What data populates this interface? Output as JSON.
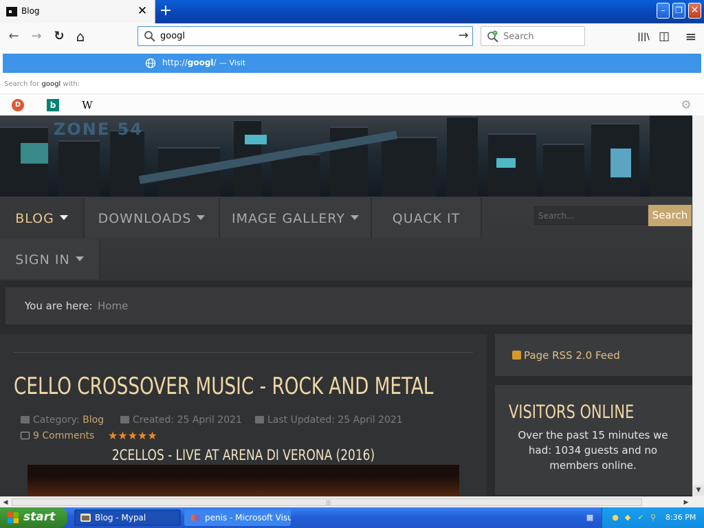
{
  "browser": {
    "tab": {
      "title": "Blog",
      "close": "✕"
    },
    "new_tab": "+",
    "window": {
      "minimize": "–",
      "restore": "❐",
      "close": "✕"
    },
    "nav": {
      "back": "←",
      "forward": "→",
      "reload": "↻",
      "home": "⌂"
    },
    "urlbar": {
      "value": "googl",
      "go": "→"
    },
    "searchbox": {
      "placeholder": "Search"
    },
    "toolbar": {
      "library": "|||\\",
      "sidebar": "◫",
      "menu": "≡"
    },
    "dropdown": {
      "suggestion_prefix": "http://",
      "suggestion_host": "googl",
      "suggestion_suffix": "/",
      "visit": "— Visit",
      "search_for_prefix": "Search for",
      "search_for_query": "googl",
      "search_for_suffix": "with:",
      "engines": {
        "ddg": "D",
        "bing": "b",
        "wiki": "W",
        "settings": "⚙"
      }
    }
  },
  "site": {
    "hero_logo": "ZONE 54",
    "menu": [
      {
        "label": "BLOG",
        "active": true,
        "has_caret": true
      },
      {
        "label": "DOWNLOADS",
        "active": false,
        "has_caret": true
      },
      {
        "label": "IMAGE GALLERY",
        "active": false,
        "has_caret": true
      },
      {
        "label": "QUACK IT",
        "active": false,
        "has_caret": false
      },
      {
        "label": "SIGN IN",
        "active": false,
        "has_caret": true
      }
    ],
    "search": {
      "placeholder": "Search...",
      "button": "Search"
    },
    "breadcrumb": {
      "label": "You are here:",
      "home": "Home"
    },
    "article": {
      "title": "CELLO CROSSOVER MUSIC - ROCK AND METAL",
      "category_label": "Category:",
      "category": "Blog",
      "created": "Created: 25 April 2021",
      "updated": "Last Updated: 25 April 2021",
      "comments": "9 Comments",
      "stars": "★★★★★",
      "video_title": "2CELLOS - LIVE AT ARENA DI VERONA (2016)"
    },
    "sidebar": {
      "rss": "Page RSS 2.0 Feed",
      "visitors_title": "VISITORS ONLINE",
      "visitors_text": "Over the past 15 minutes we had: 1034 guests and no members online."
    }
  },
  "taskbar": {
    "start": "start",
    "tasks": [
      {
        "label": "Blog - Mypal"
      },
      {
        "label": "penis - Microsoft Visu..."
      }
    ],
    "clock": "8:36 PM"
  },
  "colors": {
    "accent": "#c7a770",
    "heading": "#f0d8a6",
    "suggest": "#3d94e8",
    "taskbar": "#2260d8"
  }
}
